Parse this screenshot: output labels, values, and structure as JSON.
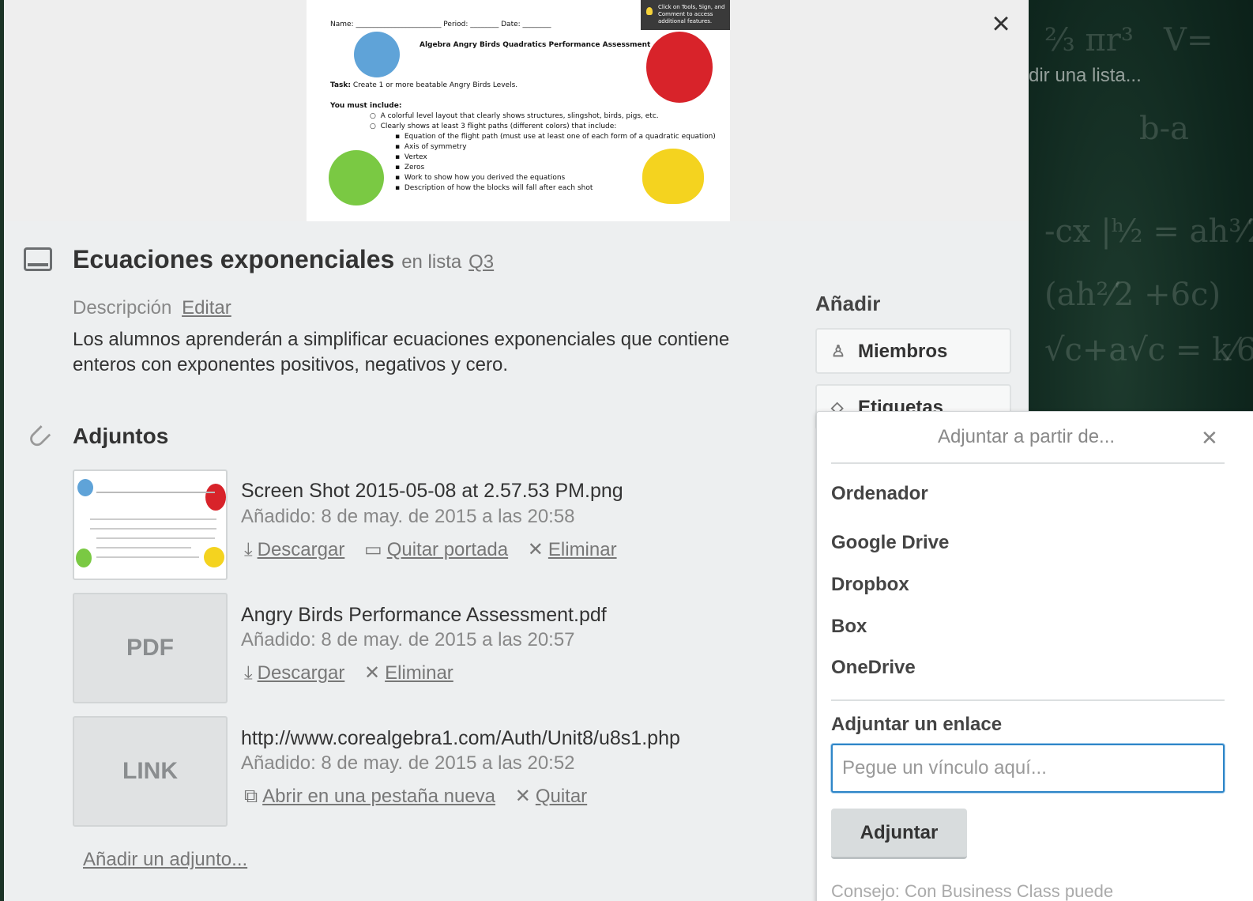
{
  "background": {
    "list_hint": "dir una lista..."
  },
  "cover": {
    "tip": "Click on Tools, Sign, and Comment to access additional features.",
    "line_name": "Name: ________________________ Period: ________ Date: ________",
    "doc_title": "Algebra Angry Birds Quadratics Performance Assessment",
    "task_label": "Task:",
    "task": "Create 1 or more beatable Angry Birds Levels.",
    "include_label": "You must include:",
    "items": [
      "A colorful level layout that clearly shows structures, slingshot, birds, pigs, etc.",
      "Clearly shows at least 3 flight paths (different colors) that include:"
    ],
    "subitems": [
      "Equation of the flight path (must use at least one of each form of a quadratic equation)",
      "Axis of symmetry",
      "Vertex",
      "Zeros",
      "Work to show how you derived the equations",
      "Description of how the blocks will fall after each shot"
    ]
  },
  "card": {
    "title": "Ecuaciones exponenciales",
    "in_list": "en lista",
    "list_name": "Q3",
    "description_label": "Descripción",
    "edit_label": "Editar",
    "description": "Los alumnos aprenderán a simplificar ecuaciones exponenciales que contiene enteros con exponentes positivos, negativos y cero."
  },
  "sidebar": {
    "title": "Añadir",
    "members": "Miembros",
    "labels": "Etiquetas"
  },
  "attachments": {
    "title": "Adjuntos",
    "items": [
      {
        "name": "Screen Shot 2015-05-08 at 2.57.53 PM.png",
        "date": "Añadido: 8 de may. de 2015 a las 20:58",
        "actions": [
          "Descargar",
          "Quitar portada",
          "Eliminar"
        ]
      },
      {
        "thumb": "PDF",
        "name": "Angry Birds Performance Assessment.pdf",
        "date": "Añadido: 8 de may. de 2015 a las 20:57",
        "actions": [
          "Descargar",
          "Eliminar"
        ]
      },
      {
        "thumb": "LINK",
        "name": "http://www.corealgebra1.com/Auth/Unit8/u8s1.php",
        "date": "Añadido: 8 de may. de 2015 a las 20:52",
        "actions": [
          "Abrir en una pestaña nueva",
          "Quitar"
        ]
      }
    ],
    "add_label": "Añadir un adjunto..."
  },
  "popover": {
    "title": "Adjuntar a partir de...",
    "sources": [
      "Ordenador",
      "Google Drive",
      "Dropbox",
      "Box",
      "OneDrive"
    ],
    "link_title": "Adjuntar un enlace",
    "link_placeholder": "Pegue un vínculo aquí...",
    "attach_button": "Adjuntar",
    "tip": "Consejo: Con Business Class puede"
  }
}
